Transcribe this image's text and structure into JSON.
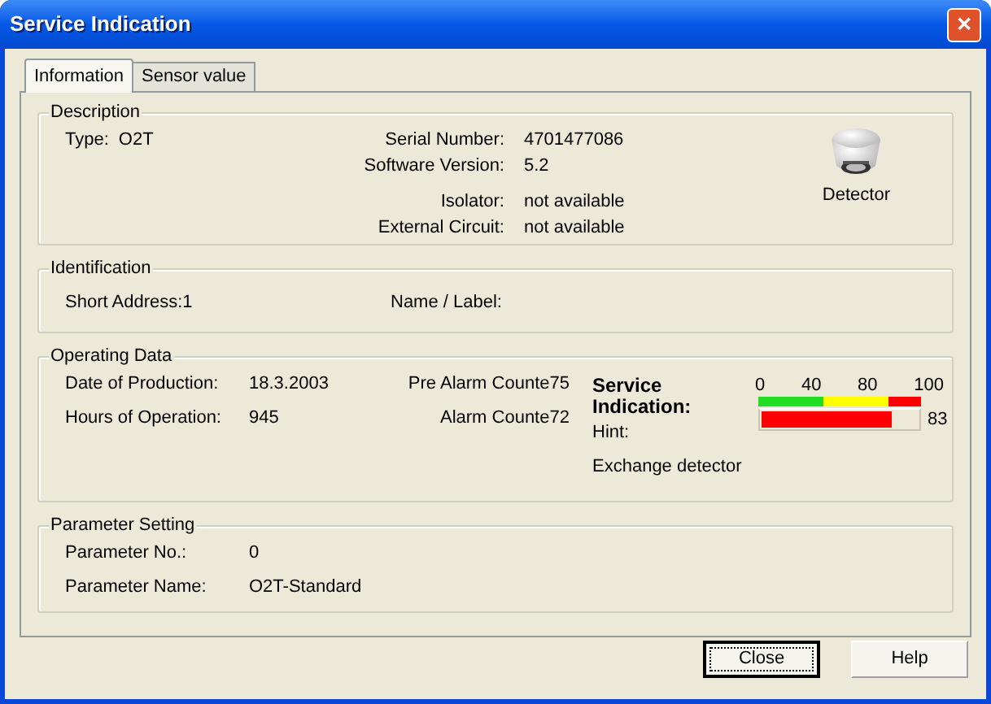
{
  "window": {
    "title": "Service Indication",
    "close_glyph": "✕"
  },
  "tabs": [
    {
      "label": "Information",
      "selected": true
    },
    {
      "label": "Sensor value",
      "selected": false
    }
  ],
  "description": {
    "title": "Description",
    "type_label": "Type:",
    "type_value": "O2T",
    "fields": [
      {
        "label": "Serial Number:",
        "value": "4701477086"
      },
      {
        "label": "Software Version:",
        "value": "5.2"
      },
      {
        "label": "Isolator:",
        "value": "not available"
      },
      {
        "label": "External Circuit:",
        "value": "not available"
      }
    ],
    "device_caption": "Detector"
  },
  "identification": {
    "title": "Identification",
    "short_address_label": "Short Address:",
    "short_address_value": "1",
    "name_label": "Name / Label:"
  },
  "operating_data": {
    "title": "Operating Data",
    "left": [
      {
        "label": "Date of Production:",
        "value": "18.3.2003"
      },
      {
        "label": "Hours of Operation:",
        "value": "945"
      }
    ],
    "counters": [
      {
        "label": "Pre Alarm Counte",
        "value": "75"
      },
      {
        "label": "Alarm Counte",
        "value": "72"
      }
    ],
    "service_title": "Service Indication:",
    "ticks": [
      "0",
      "40",
      "80",
      "100"
    ],
    "zones": [
      {
        "color": "#22dd22"
      },
      {
        "color": "#ffff00"
      },
      {
        "color": "#ff0000"
      }
    ],
    "meter": {
      "level": 0.83,
      "reading": "83"
    },
    "hint_label": "Hint:",
    "hint": "Exchange detector"
  },
  "parameter_setting": {
    "title": "Parameter Setting",
    "fields": [
      {
        "label": "Parameter No.:",
        "value": "0"
      },
      {
        "label": "Parameter Name:",
        "value": "O2T-Standard"
      }
    ]
  },
  "buttons": [
    {
      "label": "Close",
      "default": true
    },
    {
      "label": "Help",
      "default": false
    }
  ]
}
